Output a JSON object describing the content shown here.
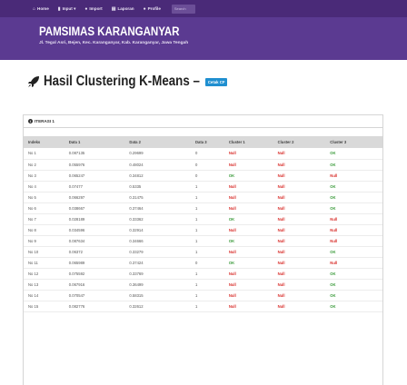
{
  "nav": {
    "items": [
      {
        "icon": "home-icon",
        "glyph": "⌂",
        "label": "Home"
      },
      {
        "icon": "chart-icon",
        "glyph": "▮",
        "label": "Input ▾"
      },
      {
        "icon": "user-icon",
        "glyph": "●",
        "label": "Import"
      },
      {
        "icon": "file-icon",
        "glyph": "▤",
        "label": "Laporan"
      },
      {
        "icon": "profile-icon",
        "glyph": "●",
        "label": "Profile"
      }
    ],
    "search_placeholder": "Search"
  },
  "header": {
    "title": "PAMSIMAS KARANGANYAR",
    "address": "Jl. Tegal Asri, Bejen, Kec. Karanganyar, Kab. Karanganyar, Jawa Tengah"
  },
  "page": {
    "heading": "Hasil Clustering K-Means –",
    "print_button": "Cetak CF",
    "panel_title": "ITERASI 1"
  },
  "table": {
    "columns": [
      "Indeks",
      "Data 1",
      "Data 2",
      "Data 3",
      "Cluster 1",
      "Cluster 2",
      "Cluster 3"
    ],
    "rows": [
      {
        "idx": "No 1",
        "d1": "0.087135",
        "d2": "0.29699",
        "d3": "0",
        "c": [
          "Null",
          "Null",
          "OK"
        ]
      },
      {
        "idx": "No 2",
        "d1": "0.055976",
        "d2": "0.48024",
        "d3": "0",
        "c": [
          "Null",
          "Null",
          "OK"
        ]
      },
      {
        "idx": "No 3",
        "d1": "0.065247",
        "d2": "0.34812",
        "d3": "0",
        "c": [
          "OK",
          "Null",
          "Null"
        ]
      },
      {
        "idx": "No 4",
        "d1": "0.07477",
        "d2": "0.5335",
        "d3": "1",
        "c": [
          "Null",
          "Null",
          "OK"
        ]
      },
      {
        "idx": "No 5",
        "d1": "0.066297",
        "d2": "0.31475",
        "d3": "1",
        "c": [
          "Null",
          "Null",
          "OK"
        ]
      },
      {
        "idx": "No 6",
        "d1": "0.038667",
        "d2": "0.37464",
        "d3": "1",
        "c": [
          "Null",
          "Null",
          "OK"
        ]
      },
      {
        "idx": "No 7",
        "d1": "0.028189",
        "d2": "0.33362",
        "d3": "1",
        "c": [
          "OK",
          "Null",
          "Null"
        ]
      },
      {
        "idx": "No 8",
        "d1": "0.034596",
        "d2": "0.32914",
        "d3": "1",
        "c": [
          "Null",
          "Null",
          "Null"
        ]
      },
      {
        "idx": "No 9",
        "d1": "0.087634",
        "d2": "0.34666",
        "d3": "1",
        "c": [
          "OK",
          "Null",
          "Null"
        ]
      },
      {
        "idx": "No 10",
        "d1": "0.06372",
        "d2": "0.33279",
        "d3": "1",
        "c": [
          "Null",
          "Null",
          "OK"
        ]
      },
      {
        "idx": "No 11",
        "d1": "0.065989",
        "d2": "0.37424",
        "d3": "0",
        "c": [
          "OK",
          "Null",
          "Null"
        ]
      },
      {
        "idx": "No 12",
        "d1": "0.075592",
        "d2": "0.33769",
        "d3": "1",
        "c": [
          "Null",
          "Null",
          "OK"
        ]
      },
      {
        "idx": "No 13",
        "d1": "0.067916",
        "d2": "0.36499",
        "d3": "1",
        "c": [
          "Null",
          "Null",
          "OK"
        ]
      },
      {
        "idx": "No 14",
        "d1": "0.070547",
        "d2": "0.58315",
        "d3": "1",
        "c": [
          "Null",
          "Null",
          "OK"
        ]
      },
      {
        "idx": "No 15",
        "d1": "0.082776",
        "d2": "0.32612",
        "d3": "1",
        "c": [
          "Null",
          "Null",
          "OK"
        ]
      }
    ]
  },
  "colors": {
    "navbar": "#4a2a78",
    "header": "#5b3a91",
    "button": "#1f8fd0",
    "ok": "#3a9a3a",
    "null": "#d9302c"
  }
}
